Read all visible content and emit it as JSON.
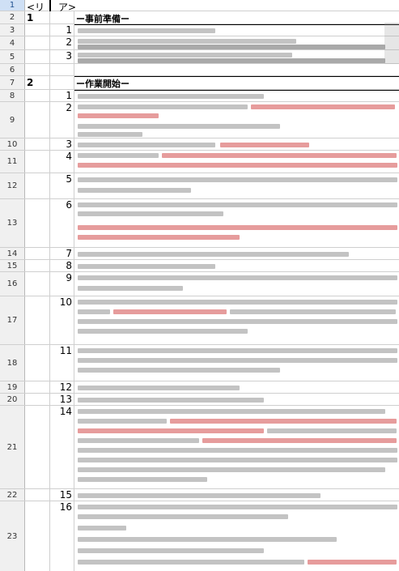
{
  "sheet": {
    "header_row": {
      "c1": "<リ",
      "c3": "ア>"
    },
    "rows": [
      {
        "row": "1",
        "sec": "",
        "num": "",
        "title": ""
      },
      {
        "row": "2",
        "sec": "1",
        "num": "",
        "title": "ー事前準備ー"
      },
      {
        "row": "3",
        "sec": "",
        "num": "1",
        "title": ""
      },
      {
        "row": "4",
        "sec": "",
        "num": "2",
        "title": ""
      },
      {
        "row": "5",
        "sec": "",
        "num": "3",
        "title": ""
      },
      {
        "row": "6",
        "sec": "",
        "num": "",
        "title": ""
      },
      {
        "row": "7",
        "sec": "2",
        "num": "",
        "title": "ー作業開始ー"
      },
      {
        "row": "8",
        "sec": "",
        "num": "1",
        "title": ""
      },
      {
        "row": "9",
        "sec": "",
        "num": "2",
        "title": ""
      },
      {
        "row": "10",
        "sec": "",
        "num": "3",
        "title": ""
      },
      {
        "row": "11",
        "sec": "",
        "num": "4",
        "title": ""
      },
      {
        "row": "12",
        "sec": "",
        "num": "5",
        "title": ""
      },
      {
        "row": "13",
        "sec": "",
        "num": "6",
        "title": ""
      },
      {
        "row": "14",
        "sec": "",
        "num": "7",
        "title": ""
      },
      {
        "row": "15",
        "sec": "",
        "num": "8",
        "title": ""
      },
      {
        "row": "16",
        "sec": "",
        "num": "9",
        "title": ""
      },
      {
        "row": "17",
        "sec": "",
        "num": "10",
        "title": ""
      },
      {
        "row": "18",
        "sec": "",
        "num": "11",
        "title": ""
      },
      {
        "row": "19",
        "sec": "",
        "num": "12",
        "title": ""
      },
      {
        "row": "20",
        "sec": "",
        "num": "13",
        "title": ""
      },
      {
        "row": "21",
        "sec": "",
        "num": "14",
        "title": ""
      },
      {
        "row": "22",
        "sec": "",
        "num": "15",
        "title": ""
      },
      {
        "row": "23",
        "sec": "",
        "num": "16",
        "title": ""
      }
    ]
  },
  "colors": {
    "grid": "#cfcfcf",
    "row_header": "#f0f0f0",
    "active_row_header": "#cfe0f5",
    "red_text": "#d23a3a"
  }
}
